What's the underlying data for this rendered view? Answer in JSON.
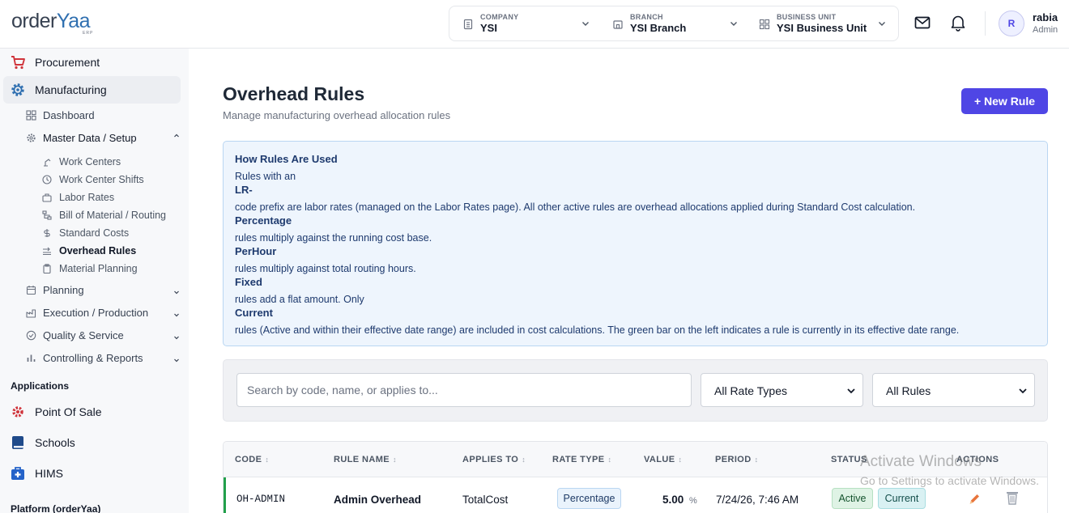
{
  "brand": {
    "name_a": "order",
    "name_b": "Yaa",
    "sub": "ERP"
  },
  "context": {
    "company": {
      "label": "COMPANY",
      "value": "YSI"
    },
    "branch": {
      "label": "BRANCH",
      "value": "YSI Branch"
    },
    "business_unit": {
      "label": "BUSINESS UNIT",
      "value": "YSI Business Unit"
    }
  },
  "user": {
    "initial": "R",
    "name": "rabia",
    "role": "Admin"
  },
  "sidebar": {
    "procurement": "Procurement",
    "manufacturing": "Manufacturing",
    "items": {
      "dashboard": "Dashboard",
      "master_data": "Master Data / Setup",
      "planning": "Planning",
      "execution": "Execution / Production",
      "quality": "Quality & Service",
      "controlling": "Controlling & Reports"
    },
    "master_children": [
      "Work Centers",
      "Work Center Shifts",
      "Labor Rates",
      "Bill of Material / Routing",
      "Standard Costs",
      "Overhead Rules",
      "Material Planning"
    ],
    "applications_title": "Applications",
    "apps": [
      "Point Of Sale",
      "Schools",
      "HIMS"
    ],
    "platform_title": "Platform (orderYaa)"
  },
  "page": {
    "title": "Overhead Rules",
    "subtitle": "Manage manufacturing overhead allocation rules",
    "new_button": "+ New Rule"
  },
  "info": {
    "title": "How Rules Are Used",
    "l1": "Rules with an",
    "l2": "LR-",
    "l3": "code prefix are labor rates (managed on the Labor Rates page). All other active rules are overhead allocations applied during Standard Cost calculation.",
    "l4": "Percentage",
    "l5": "rules multiply against the running cost base.",
    "l6": "PerHour",
    "l7": "rules multiply against total routing hours.",
    "l8": "Fixed",
    "l9": "rules add a flat amount. Only",
    "l10": "Current",
    "l11": "rules (Active and within their effective date range) are included in cost calculations. The green bar on the left indicates a rule is currently in its effective date range."
  },
  "filters": {
    "search_placeholder": "Search by code, name, or applies to...",
    "rate_type": "All Rate Types",
    "rules": "All Rules"
  },
  "table": {
    "headers": {
      "code": "CODE",
      "name": "RULE NAME",
      "applies": "APPLIES TO",
      "rate_type": "RATE TYPE",
      "value": "VALUE",
      "period": "PERIOD",
      "status": "STATUS",
      "actions": "ACTIONS"
    },
    "sort_glyph": "↕",
    "rows": [
      {
        "code": "OH-ADMIN",
        "name": "Admin Overhead",
        "applies": "TotalCost",
        "rate_type": "Percentage",
        "value": "5.00",
        "unit": "%",
        "period": "7/24/26, 7:46 AM",
        "status": "Active",
        "current": "Current"
      }
    ]
  },
  "watermark": {
    "line1": "Activate Windows",
    "line2": "Go to Settings to activate Windows."
  }
}
